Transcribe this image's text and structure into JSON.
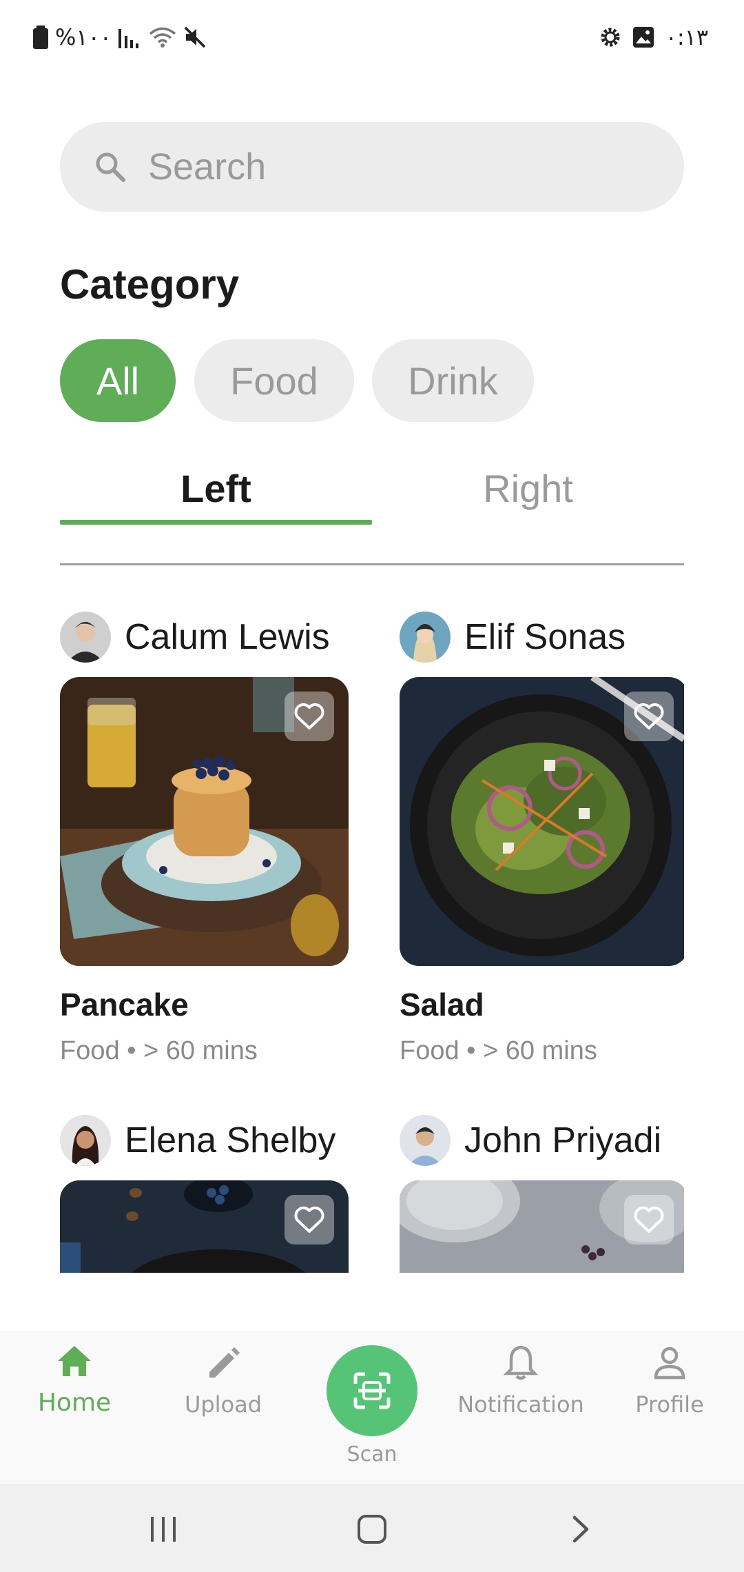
{
  "status_bar": {
    "battery_text": "%۱۰۰",
    "time": "۰:۱۳",
    "icons": [
      "battery-icon",
      "signal-icon",
      "wifi-icon",
      "mute-icon",
      "settings-icon",
      "image-icon"
    ]
  },
  "search": {
    "placeholder": "Search",
    "icon": "search-icon"
  },
  "category": {
    "title": "Category",
    "chips": [
      {
        "label": "All",
        "selected": true
      },
      {
        "label": "Food",
        "selected": false
      },
      {
        "label": "Drink",
        "selected": false
      }
    ]
  },
  "tabs": [
    {
      "label": "Left",
      "selected": true
    },
    {
      "label": "Right",
      "selected": false
    }
  ],
  "cards": [
    {
      "author": "Calum Lewis",
      "title": "Pancake",
      "meta": "Food • > 60 mins"
    },
    {
      "author": "Elif Sonas",
      "title": "Salad",
      "meta": "Food • > 60 mins"
    },
    {
      "author": "Elena Shelby"
    },
    {
      "author": "John Priyadi"
    }
  ],
  "bottom_nav": {
    "items": [
      {
        "label": "Home",
        "icon": "home-icon",
        "active": true
      },
      {
        "label": "Upload",
        "icon": "pencil-icon",
        "active": false
      },
      {
        "label": "Scan",
        "icon": "scan-icon",
        "active": false
      },
      {
        "label": "Notification",
        "icon": "bell-icon",
        "active": false
      },
      {
        "label": "Profile",
        "icon": "person-icon",
        "active": false
      }
    ]
  },
  "colors": {
    "accent": "#5fad56",
    "scan_button": "#56c477",
    "chip_inactive": "#ececec",
    "muted_text": "#9a9a9a"
  }
}
